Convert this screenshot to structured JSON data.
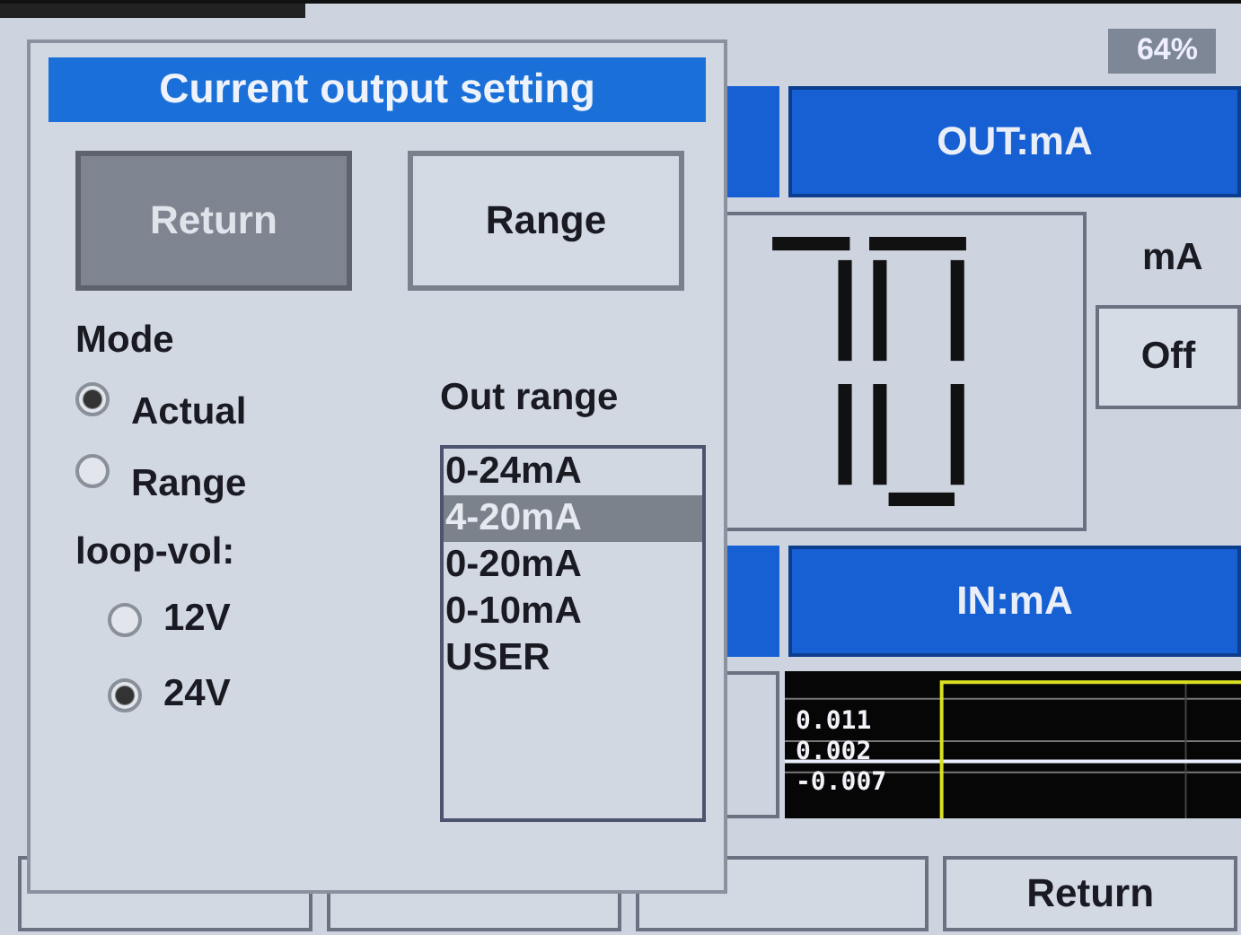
{
  "status": {
    "battery": "64%"
  },
  "output": {
    "header": "OUT:mA",
    "unit": "mA",
    "toggle": "Off"
  },
  "input": {
    "header": "IN:mA",
    "plot_labels": [
      "0.011",
      "0.002",
      "-0.007"
    ]
  },
  "bottom_buttons": [
    {
      "kind": "blank"
    },
    {
      "kind": "blank"
    },
    {
      "kind": "blank"
    },
    {
      "kind": "labeled",
      "label": "Return"
    }
  ],
  "dialog": {
    "title": "Current output setting",
    "buttons": [
      {
        "label": "Return",
        "selected": true
      },
      {
        "label": "Range",
        "selected": false
      }
    ],
    "mode": {
      "label": "Mode",
      "options": [
        {
          "label": "Actual",
          "selected": true
        },
        {
          "label": "Range",
          "selected": false
        }
      ]
    },
    "loop_vol": {
      "label": "loop-vol:",
      "options": [
        {
          "label": "12V",
          "selected": false
        },
        {
          "label": "24V",
          "selected": true
        }
      ]
    },
    "out_range": {
      "label": "Out range",
      "items": [
        {
          "label": "0-24mA",
          "selected": false
        },
        {
          "label": "4-20mA",
          "selected": true
        },
        {
          "label": "0-20mA",
          "selected": false
        },
        {
          "label": "0-10mA",
          "selected": false
        },
        {
          "label": "USER",
          "selected": false
        }
      ]
    }
  }
}
